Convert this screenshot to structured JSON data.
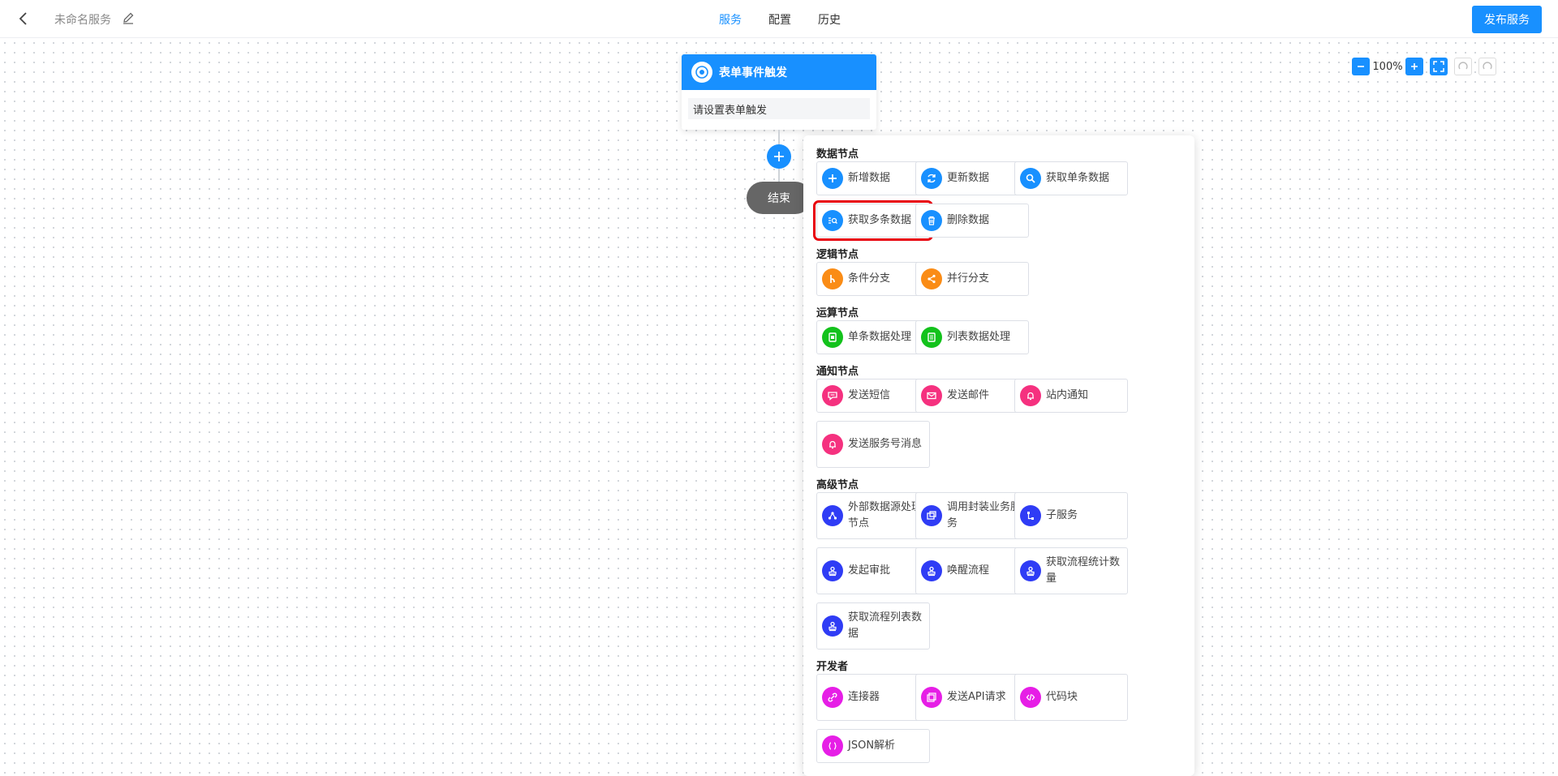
{
  "header": {
    "service_name": "未命名服务",
    "tabs": [
      "服务",
      "配置",
      "历史"
    ],
    "active_tab": 0,
    "publish_label": "发布服务"
  },
  "zoom": {
    "value": "100%"
  },
  "trigger_node": {
    "title": "表单事件触发",
    "body": "请设置表单触发"
  },
  "end_node": {
    "label": "结束"
  },
  "panel": {
    "sections": [
      {
        "title": "数据节点",
        "items": [
          {
            "label": "新增数据",
            "icon": "plus-icon",
            "color": "#1890ff"
          },
          {
            "label": "更新数据",
            "icon": "refresh-icon",
            "color": "#1890ff"
          },
          {
            "label": "获取单条数据",
            "icon": "search-icon",
            "color": "#1890ff"
          },
          {
            "label": "获取多条数据",
            "icon": "multi-search-icon",
            "color": "#1890ff",
            "highlighted": true
          },
          {
            "label": "删除数据",
            "icon": "trash-icon",
            "color": "#1890ff"
          }
        ]
      },
      {
        "title": "逻辑节点",
        "items": [
          {
            "label": "条件分支",
            "icon": "branch-icon",
            "color": "#fa8c16"
          },
          {
            "label": "并行分支",
            "icon": "share-icon",
            "color": "#fa8c16"
          }
        ]
      },
      {
        "title": "运算节点",
        "items": [
          {
            "label": "单条数据处理",
            "icon": "record-icon",
            "color": "#13c21c"
          },
          {
            "label": "列表数据处理",
            "icon": "list-icon",
            "color": "#13c21c"
          }
        ]
      },
      {
        "title": "通知节点",
        "items": [
          {
            "label": "发送短信",
            "icon": "sms-icon",
            "color": "#f5317f"
          },
          {
            "label": "发送邮件",
            "icon": "mail-icon",
            "color": "#f5317f"
          },
          {
            "label": "站内通知",
            "icon": "bell-icon",
            "color": "#f5317f"
          },
          {
            "label": "发送服务号消息",
            "icon": "bell-icon",
            "color": "#f5317f"
          }
        ]
      },
      {
        "title": "高级节点",
        "items": [
          {
            "label": "外部数据源处理节点",
            "icon": "datasource-icon",
            "color": "#2f3cf5"
          },
          {
            "label": "调用封装业务服务",
            "icon": "service-icon",
            "color": "#2f3cf5"
          },
          {
            "label": "子服务",
            "icon": "subservice-icon",
            "color": "#2f3cf5"
          },
          {
            "label": "发起审批",
            "icon": "stamp-icon",
            "color": "#2f3cf5"
          },
          {
            "label": "唤醒流程",
            "icon": "stamp-icon",
            "color": "#2f3cf5"
          },
          {
            "label": "获取流程统计数量",
            "icon": "stamp-icon",
            "color": "#2f3cf5"
          },
          {
            "label": "获取流程列表数据",
            "icon": "stamp-icon",
            "color": "#2f3cf5"
          }
        ]
      },
      {
        "title": "开发者",
        "items": [
          {
            "label": "连接器",
            "icon": "link-icon",
            "color": "#e61ee6"
          },
          {
            "label": "发送API请求",
            "icon": "api-icon",
            "color": "#e61ee6"
          },
          {
            "label": "代码块",
            "icon": "code-icon",
            "color": "#e61ee6"
          },
          {
            "label": "JSON解析",
            "icon": "json-icon",
            "color": "#e61ee6"
          }
        ]
      }
    ]
  }
}
